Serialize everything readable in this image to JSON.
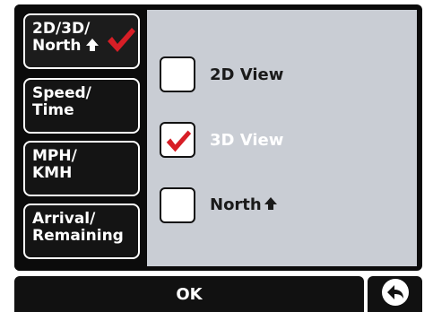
{
  "sidebar": {
    "items": [
      {
        "line1": "2D/3D/",
        "line2": "North",
        "icon": "up-arrow-icon",
        "active": true,
        "active_icon": "checkmark-icon"
      },
      {
        "line1": "Speed/",
        "line2": "Time"
      },
      {
        "line1": "MPH/",
        "line2": "KMH"
      },
      {
        "line1": "Arrival/",
        "line2": "Remaining"
      }
    ]
  },
  "options": [
    {
      "label": "2D View",
      "checked": false
    },
    {
      "label": "3D View",
      "checked": true
    },
    {
      "label": "North",
      "icon": "up-arrow-icon",
      "checked": false
    }
  ],
  "footer": {
    "ok_label": "OK",
    "back_icon": "back-arrow-icon"
  },
  "colors": {
    "content_bg": "#c9cdd4",
    "frame_bg": "#0b0b0b",
    "check_red": "#d71e26",
    "selected_text": "#ffffff"
  }
}
